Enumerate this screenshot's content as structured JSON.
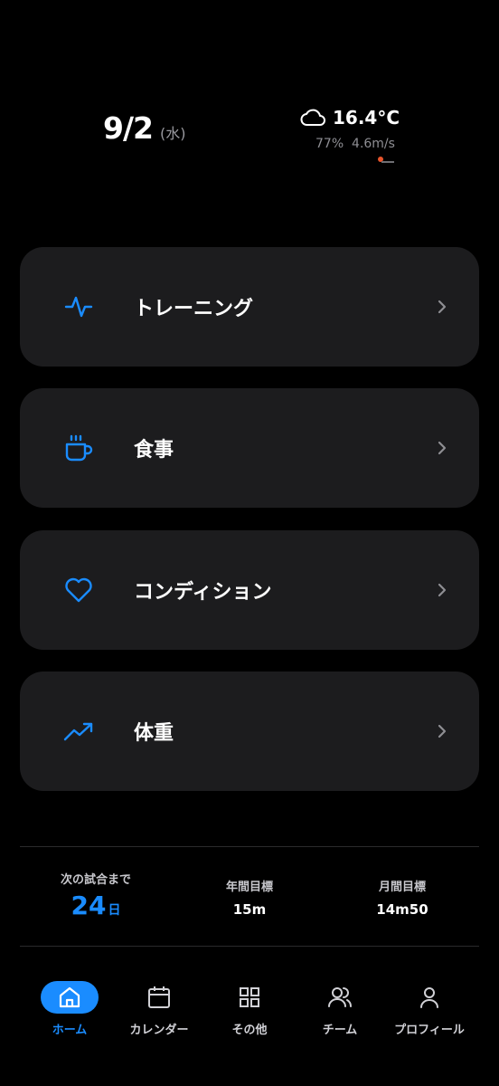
{
  "header": {
    "date": "9/2",
    "weekday": "(水)"
  },
  "weather": {
    "icon": "cloud-icon",
    "temperature": "16.4°C",
    "humidity": "77%",
    "wind": "4.6m/s",
    "logo": "weather-logo"
  },
  "menu": {
    "items": [
      {
        "icon": "activity-pulse-icon",
        "label": "トレーニング"
      },
      {
        "icon": "coffee-cup-icon",
        "label": "食事"
      },
      {
        "icon": "heart-icon",
        "label": "コンディション"
      },
      {
        "icon": "trending-up-icon",
        "label": "体重"
      }
    ]
  },
  "stats": {
    "countdown": {
      "label": "次の試合まで",
      "value": "24",
      "unit": "日"
    },
    "yearly": {
      "label": "年間目標",
      "value": "15m"
    },
    "monthly": {
      "label": "月間目標",
      "value": "14m50"
    }
  },
  "tabbar": {
    "active": 0,
    "accent": "#1a8cff",
    "tabs": [
      {
        "icon": "home-icon",
        "label": "ホーム"
      },
      {
        "icon": "calendar-icon",
        "label": "カレンダー"
      },
      {
        "icon": "grid-icon",
        "label": "その他"
      },
      {
        "icon": "team-icon",
        "label": "チーム"
      },
      {
        "icon": "user-icon",
        "label": "プロフィール"
      }
    ]
  }
}
